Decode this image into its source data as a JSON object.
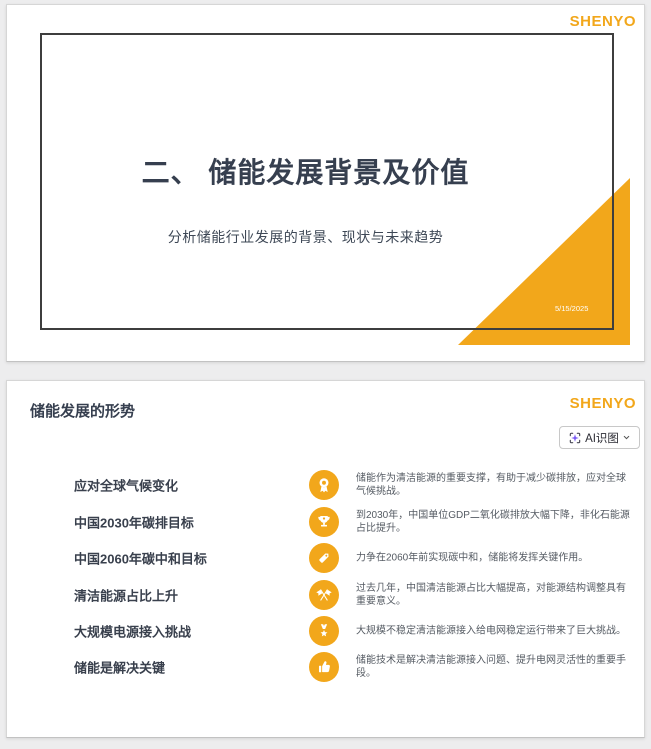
{
  "brand": {
    "name": "SHENYO"
  },
  "slide1": {
    "logo": "SHENYO",
    "title": "二、 储能发展背景及价值",
    "subtitle": "分析储能行业发展的背景、现状与未来趋势",
    "date": "5/15/2025"
  },
  "slide2": {
    "logo": "SHENYO",
    "title": "储能发展的形势",
    "ai_button": {
      "label": "AI识图",
      "icon": "ai-scan-sparkle-icon",
      "chevron": "chevron-down-icon"
    },
    "items": [
      {
        "label": "应对全球气候变化",
        "icon": "award-rosette-icon",
        "desc": "储能作为清洁能源的重要支撑，有助于减少碳排放，应对全球气候挑战。"
      },
      {
        "label": "中国2030年碳排目标",
        "icon": "trophy-icon",
        "desc": "到2030年，中国单位GDP二氧化碳排放大幅下降，非化石能源占比提升。"
      },
      {
        "label": "中国2060年碳中和目标",
        "icon": "price-tag-icon",
        "desc": "力争在2060年前实现碳中和，储能将发挥关键作用。"
      },
      {
        "label": "清洁能源占比上升",
        "icon": "crossed-flags-icon",
        "desc": "过去几年，中国清洁能源占比大幅提高，对能源结构调整具有重要意义。"
      },
      {
        "label": "大规模电源接入挑战",
        "icon": "medal-star-icon",
        "desc": "大规模不稳定清洁能源接入给电网稳定运行带来了巨大挑战。"
      },
      {
        "label": "储能是解决关键",
        "icon": "thumbs-up-icon",
        "desc": "储能技术是解决清洁能源接入问题、提升电网灵活性的重要手段。"
      }
    ]
  },
  "colors": {
    "accent": "#F2A71B",
    "title_text": "#363F4F",
    "body_text": "#555B63",
    "frame_border": "#3E3E3E",
    "ai_star_purple": "#7B5BF5",
    "page_background": "#ededee"
  }
}
